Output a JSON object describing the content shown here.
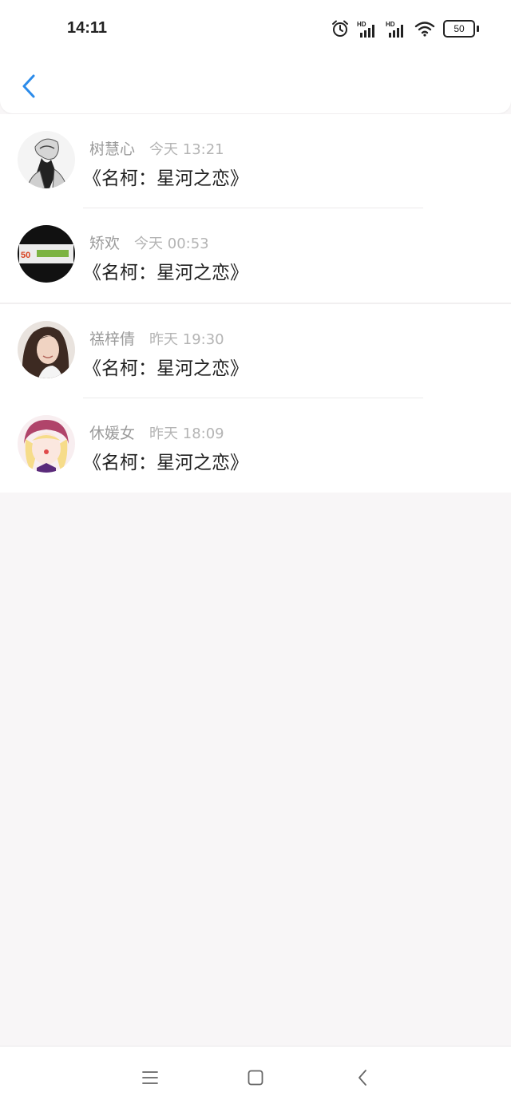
{
  "status_bar": {
    "time": "14:11",
    "battery": "50",
    "signal_label": "HD"
  },
  "header": {
    "back_icon": "chevron-left-icon",
    "accent_color": "#2b8bea"
  },
  "messages": [
    {
      "name": "树慧心",
      "time": "今天 13:21",
      "title": "《名柯：星河之恋》",
      "avatar": "avatar-sketch-figure"
    },
    {
      "name": "矫欢",
      "time": "今天 00:53",
      "title": "《名柯：星河之恋》",
      "avatar": "avatar-logo-badge",
      "avatar_text": "50"
    },
    {
      "name": "禚梓倩",
      "time": "昨天 19:30",
      "title": "《名柯：星河之恋》",
      "avatar": "avatar-woman-portrait"
    },
    {
      "name": "休媛女",
      "time": "昨天 18:09",
      "title": "《名柯：星河之恋》",
      "avatar": "avatar-anime-girl"
    }
  ],
  "nav_bar": {
    "menu_icon": "menu-icon",
    "home_icon": "square-home-icon",
    "back_icon": "back-triangle-icon"
  }
}
